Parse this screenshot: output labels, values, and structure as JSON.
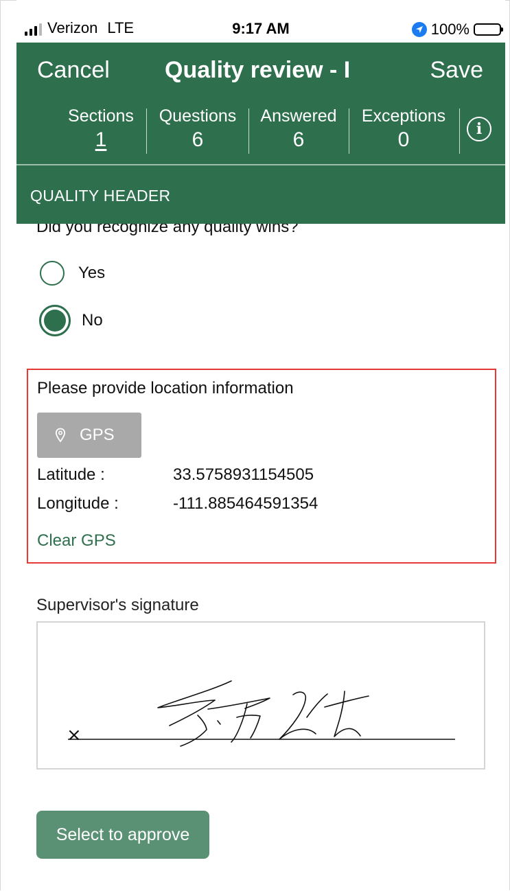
{
  "status_bar": {
    "carrier": "Verizon",
    "network": "LTE",
    "time": "9:17 AM",
    "battery": "100%"
  },
  "header": {
    "cancel_label": "Cancel",
    "title": "Quality review - I",
    "save_label": "Save",
    "stats": [
      {
        "label": "Sections",
        "value": "1"
      },
      {
        "label": "Questions",
        "value": "6"
      },
      {
        "label": "Answered",
        "value": "6"
      },
      {
        "label": "Exceptions",
        "value": "0"
      }
    ],
    "section_title": "QUALITY HEADER"
  },
  "form": {
    "question": "Did you recognize any quality wins?",
    "options": [
      {
        "label": "Yes",
        "selected": false
      },
      {
        "label": "No",
        "selected": true
      }
    ],
    "location": {
      "title": "Please provide location information",
      "gps_button": "GPS",
      "latitude_label": "Latitude :",
      "latitude_value": "33.5758931154505",
      "longitude_label": "Longitude :",
      "longitude_value": "-111.885464591354",
      "clear_label": "Clear GPS"
    },
    "signature_label": "Supervisor's signature",
    "signature_mark": "×",
    "approve_button": "Select to approve"
  },
  "colors": {
    "header_green": "#2e6f4e",
    "radio_green": "#2e6f4e",
    "approve_button": "#5a9174",
    "highlight_border": "#e53935",
    "gps_button": "#a9a9a9",
    "location_icon_blue": "#1a7cf0"
  }
}
